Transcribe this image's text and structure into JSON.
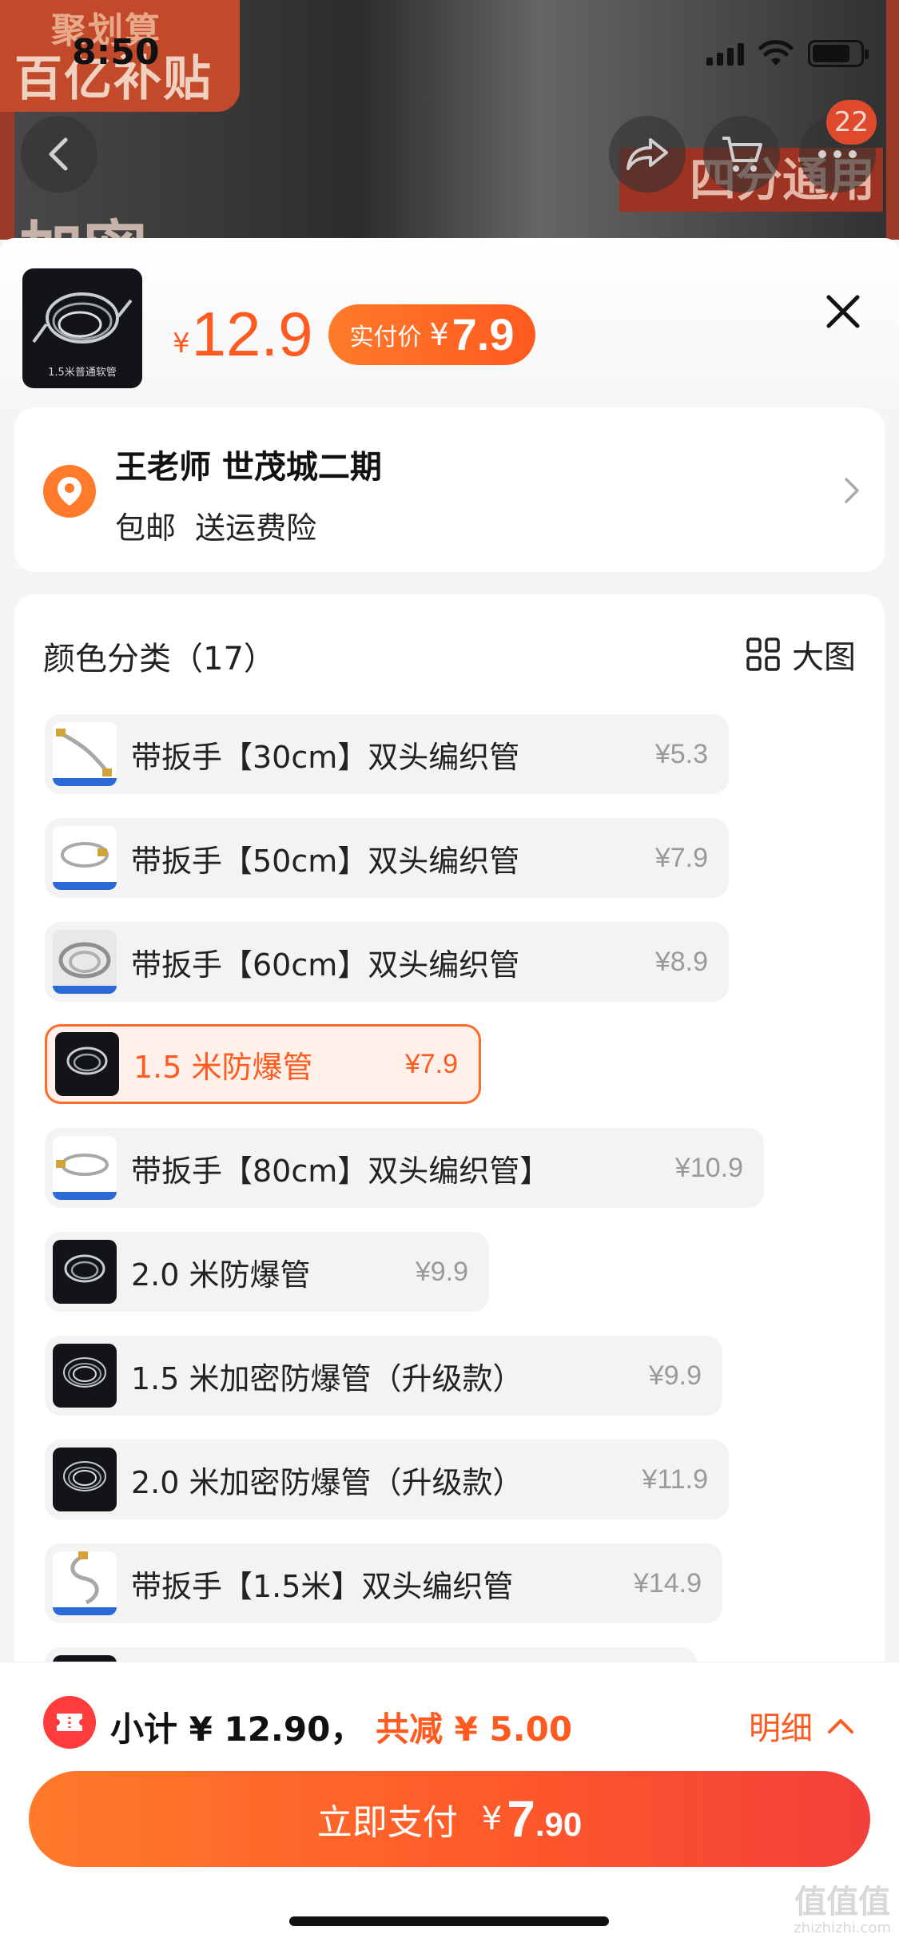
{
  "status_bar": {
    "time": "8:50"
  },
  "background": {
    "banner_line1": "聚划算",
    "banner_line2": "百亿补贴",
    "right_text": "四分通用",
    "bottom_text": "加密",
    "cart_count": "22"
  },
  "sheet": {
    "price_yen": "¥",
    "price": "12.9",
    "paid_label": "实付价",
    "paid_yen": "¥",
    "paid_price": "7.9",
    "thumb_caption": "1.5米普通软管"
  },
  "address": {
    "name": "王老师 世茂城二期",
    "shipping": "包邮  送运费险"
  },
  "spec": {
    "title": "颜色分类（17）",
    "big_view": "大图",
    "options": [
      {
        "label": "带扳手【30cm】双头编织管",
        "price": "¥5.3",
        "selected": false
      },
      {
        "label": "带扳手【50cm】双头编织管",
        "price": "¥7.9",
        "selected": false
      },
      {
        "label": "带扳手【60cm】双头编织管",
        "price": "¥8.9",
        "selected": false
      },
      {
        "label": "1.5 米防爆管",
        "price": "¥7.9",
        "selected": true
      },
      {
        "label": "带扳手【80cm】双头编织管】",
        "price": "¥10.9",
        "selected": false
      },
      {
        "label": "2.0 米防爆管",
        "price": "¥9.9",
        "selected": false
      },
      {
        "label": "1.5 米加密防爆管（升级款）",
        "price": "¥9.9",
        "selected": false
      },
      {
        "label": "2.0 米加密防爆管（升级款）",
        "price": "¥11.9",
        "selected": false
      },
      {
        "label": "带扳手【1.5米】双头编织管",
        "price": "¥14.9",
        "selected": false
      }
    ]
  },
  "summary": {
    "subtotal": "小计 ¥ 12.90，",
    "discount": "共减 ¥ 5.00",
    "detail": "明细"
  },
  "pay": {
    "label": "立即支付",
    "yen": "¥",
    "int": "7",
    "dec": ".90"
  },
  "watermark": {
    "main": "值值值",
    "sub": "zhizhizhi.com"
  },
  "colors": {
    "accent": "#ff5a1f",
    "accent_light": "#fff1ea"
  }
}
